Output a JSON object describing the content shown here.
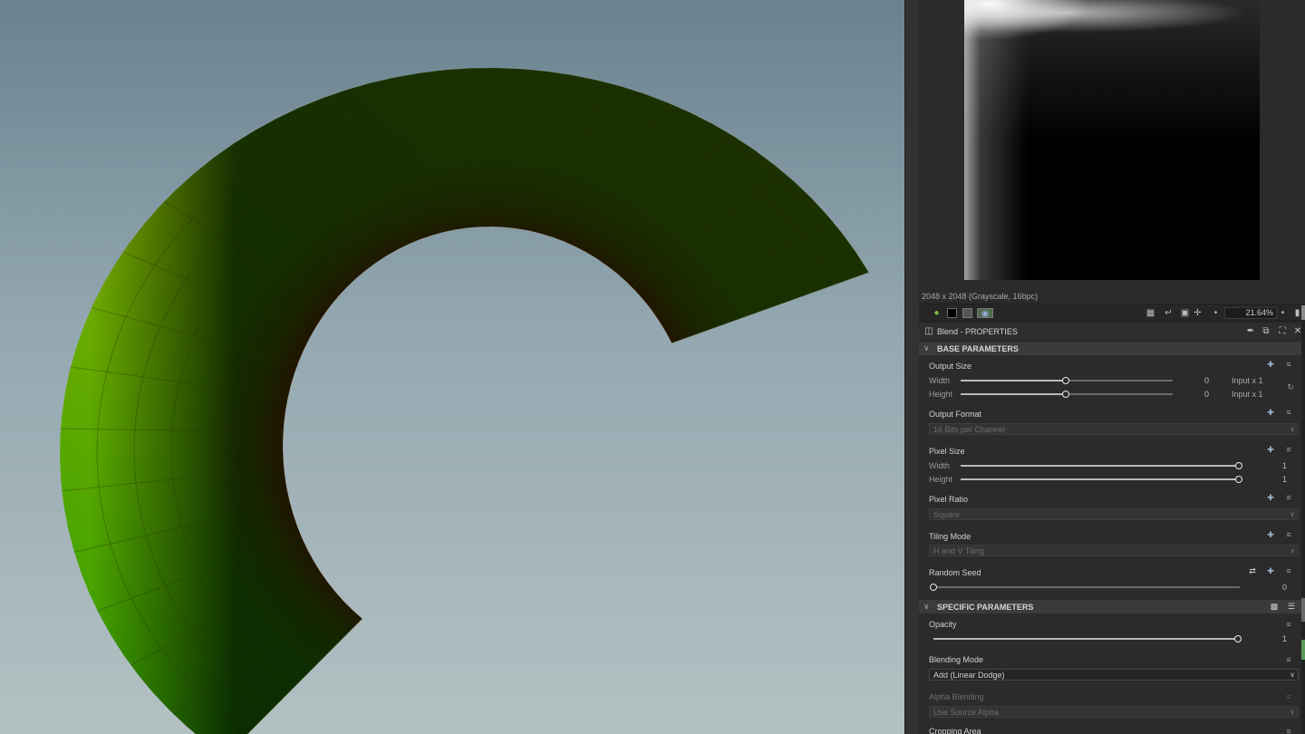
{
  "preview": {
    "info": "2048 x 2048 (Grayscale, 16bpc)",
    "zoom": "21.64%"
  },
  "panel": {
    "title": "Blend - PROPERTIES"
  },
  "base_section": {
    "label": "BASE PARAMETERS",
    "output_size": {
      "label": "Output Size",
      "width_label": "Width",
      "height_label": "Height",
      "width_value": "0",
      "height_value": "0",
      "width_rel": "Input x 1",
      "height_rel": "Input x 1"
    },
    "output_format": {
      "label": "Output Format",
      "value": "16 Bits per Channel"
    },
    "pixel_size": {
      "label": "Pixel Size",
      "width_label": "Width",
      "height_label": "Height",
      "width_value": "1",
      "height_value": "1"
    },
    "pixel_ratio": {
      "label": "Pixel Ratio",
      "value": "Square"
    },
    "tiling_mode": {
      "label": "Tiling Mode",
      "value": "H and V Tiling"
    },
    "random_seed": {
      "label": "Random Seed",
      "value": "0"
    }
  },
  "specific_section": {
    "label": "SPECIFIC PARAMETERS",
    "opacity": {
      "label": "Opacity",
      "value": "1",
      "level": 1.0
    },
    "blending_mode": {
      "label": "Blending Mode",
      "value": "Add (Linear Dodge)"
    },
    "alpha_blending": {
      "label": "Alpha Blending",
      "value": "Use Source Alpha"
    },
    "cropping_area": {
      "label": "Cropping Area"
    }
  },
  "colors": {
    "viewport_top": "#6a8290",
    "viewport_bottom": "#b4c1c3",
    "mesh_green": "#2ea000",
    "mesh_yellow": "#c9b800",
    "mesh_red": "#d40000",
    "panel_bg": "#2b2b2b"
  }
}
